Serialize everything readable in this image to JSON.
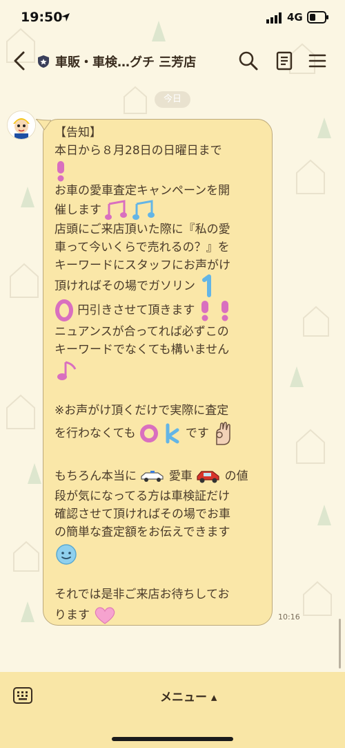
{
  "status": {
    "time": "19:50",
    "network": "4G"
  },
  "header": {
    "title": "車販・車検…グチ 三芳店",
    "colors": {
      "text": "#3a2d1f",
      "shield": "#3a3f5a"
    }
  },
  "chat": {
    "date_label": "今日",
    "message": {
      "lines": [
        "【告知】",
        "本日から８月28日の日曜日まで",
        "",
        "お車の愛車査定キャンペーンを開",
        "催します",
        "店頭にご来店頂いた際に『私の愛",
        "車って今いくらで売れるの？』を",
        "キーワードにスタッフにお声がけ",
        "頂ければその場でガソリン",
        "円引きさせて頂きます",
        "ニュアンスが合ってれば必ずこの",
        "キーワードでなくても構いません",
        "",
        "",
        "※お声がけ頂くだけで実際に査定",
        "を行わなくても",
        "です",
        "",
        "もちろん本当に",
        "愛車",
        "の値",
        "段が気になってる方は車検証だけ",
        "確認させて頂ければその場でお車",
        "の簡単な査定額をお伝えできます",
        "",
        "それでは是非ご来店お待ちしてお",
        "ります"
      ],
      "time": "10:16",
      "bubble_color": "#fae7a8"
    }
  },
  "footer": {
    "menu_label": "メニュー ▴"
  }
}
